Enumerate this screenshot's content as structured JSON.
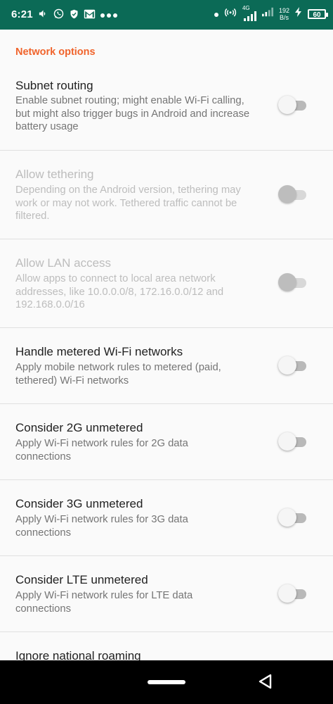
{
  "status_bar": {
    "time": "6:21",
    "network_label": "4G",
    "speed_value": "192",
    "speed_unit": "B/s",
    "battery": "60",
    "icons": [
      "whatsapp-icon",
      "shield-icon",
      "gmail-icon",
      "more-dots-icon",
      "dot-icon",
      "hotspot-icon",
      "signal-icon",
      "signal-icon",
      "charging-icon"
    ]
  },
  "settings": {
    "section_title": "Network options",
    "items": [
      {
        "title": "Subnet routing",
        "summary": "Enable subnet routing; might enable Wi-Fi calling, but might also trigger bugs in Android and increase battery usage",
        "enabled": true,
        "checked": false
      },
      {
        "title": "Allow tethering",
        "summary": "Depending on the Android version, tethering may work or may not work. Tethered traffic cannot be filtered.",
        "enabled": false,
        "checked": false
      },
      {
        "title": "Allow LAN access",
        "summary": "Allow apps to connect to local area network addresses, like 10.0.0.0/8, 172.16.0.0/12 and 192.168.0.0/16",
        "enabled": false,
        "checked": false
      },
      {
        "title": "Handle metered Wi-Fi networks",
        "summary": "Apply mobile network rules to metered (paid, tethered) Wi-Fi networks",
        "enabled": true,
        "checked": false
      },
      {
        "title": "Consider 2G unmetered",
        "summary": "Apply Wi-Fi network rules for 2G data connections",
        "enabled": true,
        "checked": false
      },
      {
        "title": "Consider 3G unmetered",
        "summary": "Apply Wi-Fi network rules for 3G data connections",
        "enabled": true,
        "checked": false
      },
      {
        "title": "Consider LTE unmetered",
        "summary": "Apply Wi-Fi network rules for LTE data connections",
        "enabled": true,
        "checked": false
      },
      {
        "title": "Ignore national roaming",
        "summary": "",
        "enabled": true,
        "checked": false
      }
    ]
  },
  "colors": {
    "status_bar": "#0b6a56",
    "accent": "#f0632b",
    "background": "#fafafa"
  }
}
